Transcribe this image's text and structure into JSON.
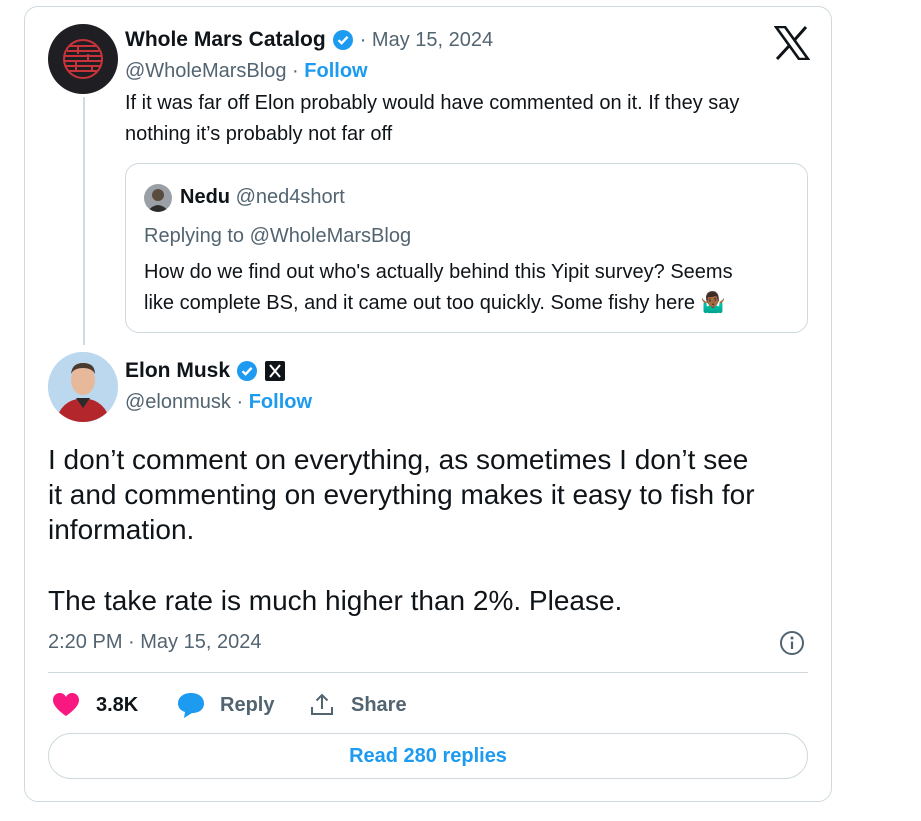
{
  "parent_tweet": {
    "author_name": "Whole Mars Catalog",
    "separator_date": "· May 15, 2024",
    "handle": "@WholeMarsBlog",
    "dot": "·",
    "follow_label": "Follow",
    "text_line1": "If it was far off Elon probably would have commented on it. If they say",
    "text_line2": "nothing it’s probably not far off",
    "avatar_icon": "circular-maze-avatar"
  },
  "quoted_tweet": {
    "author_name": "Nedu",
    "handle": "@ned4short",
    "replying_prefix": "Replying to ",
    "replying_handle": "@WholeMarsBlog",
    "text_line1": "How do we find out who's actually behind this Yipit survey? Seems",
    "text_line2": "like complete BS, and it came out too quickly. Some fishy here 🤷🏾‍♂️"
  },
  "main_tweet": {
    "author_name": "Elon Musk",
    "handle": "@elonmusk",
    "dot": "·",
    "follow_label": "Follow",
    "text_line1": "I don’t comment on everything, as sometimes I don’t see",
    "text_line2": "it and commenting on everything makes it easy to fish for",
    "text_line3": "information.",
    "text_line4": "The take rate is much higher than 2%. Please.",
    "timestamp": "2:20 PM · May 15, 2024"
  },
  "actions": {
    "like_count": "3.8K",
    "reply_label": "Reply",
    "share_label": "Share"
  },
  "read_replies_label": "Read 280 replies",
  "colors": {
    "accent": "#1d9bf0",
    "like": "#f91880",
    "text": "#0f1419",
    "muted": "#536471",
    "border": "#cfd9de"
  },
  "icons": [
    "x-logo-icon",
    "verified-badge-icon",
    "x-affiliate-badge-icon",
    "heart-icon",
    "reply-bubble-icon",
    "share-icon",
    "info-icon"
  ]
}
